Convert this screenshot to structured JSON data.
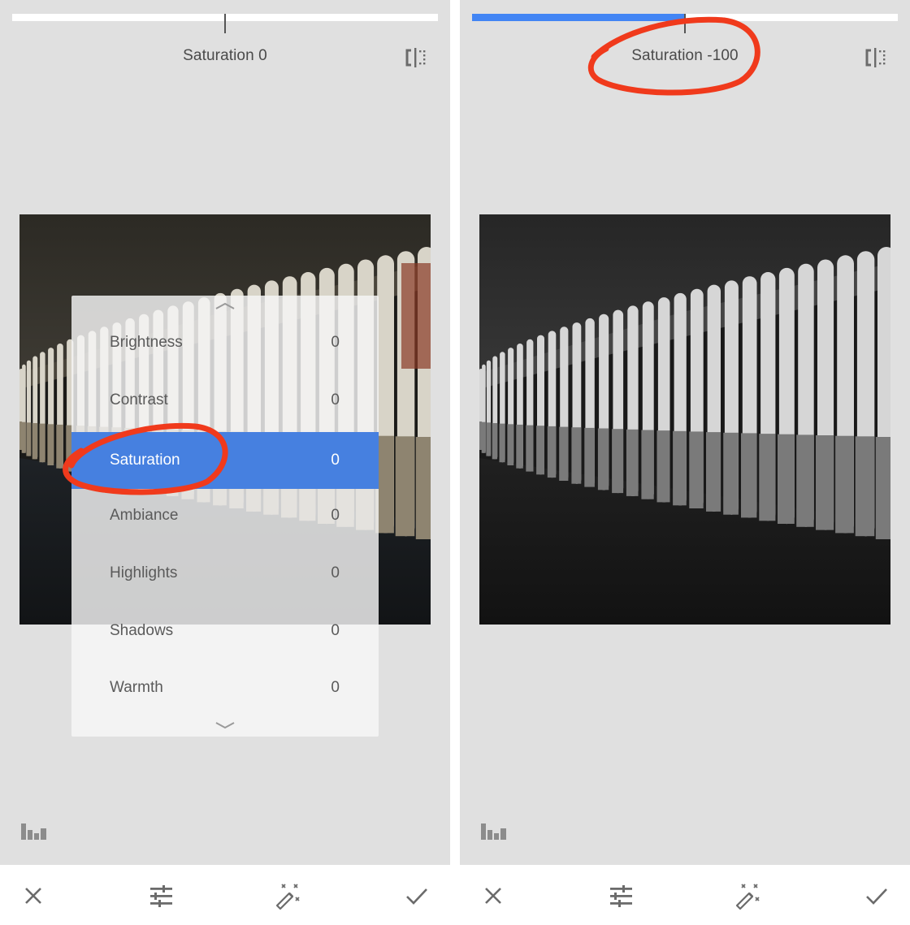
{
  "colors": {
    "accent_blue": "#4285f4",
    "menu_selected": "#4680e0",
    "annotation_red": "#f03a1c",
    "stage_gray": "#e0e0e0",
    "icon_gray": "#6b6b6b"
  },
  "panels": [
    {
      "id": "before",
      "slider": {
        "value": 0,
        "min": -100,
        "max": 100
      },
      "parameter_label": "Saturation 0",
      "photo": {
        "description": "parking garage colonnade, color",
        "mode": "color"
      },
      "adjust_menu": {
        "visible": true,
        "scroll_up_icon": "chevron-up-icon",
        "scroll_down_icon": "chevron-down-icon",
        "items": [
          {
            "name": "Brightness",
            "value": "0",
            "selected": false
          },
          {
            "name": "Contrast",
            "value": "0",
            "selected": false
          },
          {
            "name": "Saturation",
            "value": "0",
            "selected": true
          },
          {
            "name": "Ambiance",
            "value": "0",
            "selected": false
          },
          {
            "name": "Highlights",
            "value": "0",
            "selected": false
          },
          {
            "name": "Shadows",
            "value": "0",
            "selected": false
          },
          {
            "name": "Warmth",
            "value": "0",
            "selected": false
          }
        ]
      },
      "annotation": "red circle around Saturation menu item"
    },
    {
      "id": "after",
      "slider": {
        "value": -100,
        "min": -100,
        "max": 100
      },
      "parameter_label": "Saturation -100",
      "photo": {
        "description": "parking garage colonnade, black and white",
        "mode": "grayscale"
      },
      "adjust_menu": {
        "visible": false
      },
      "annotation": "red circle around Saturation -100 label"
    }
  ],
  "icons": {
    "compare": "compare-split-icon",
    "histogram": "histogram-icon",
    "cancel": "close-icon",
    "tune": "tune-sliders-icon",
    "auto": "magic-wand-icon",
    "apply": "checkmark-icon"
  }
}
